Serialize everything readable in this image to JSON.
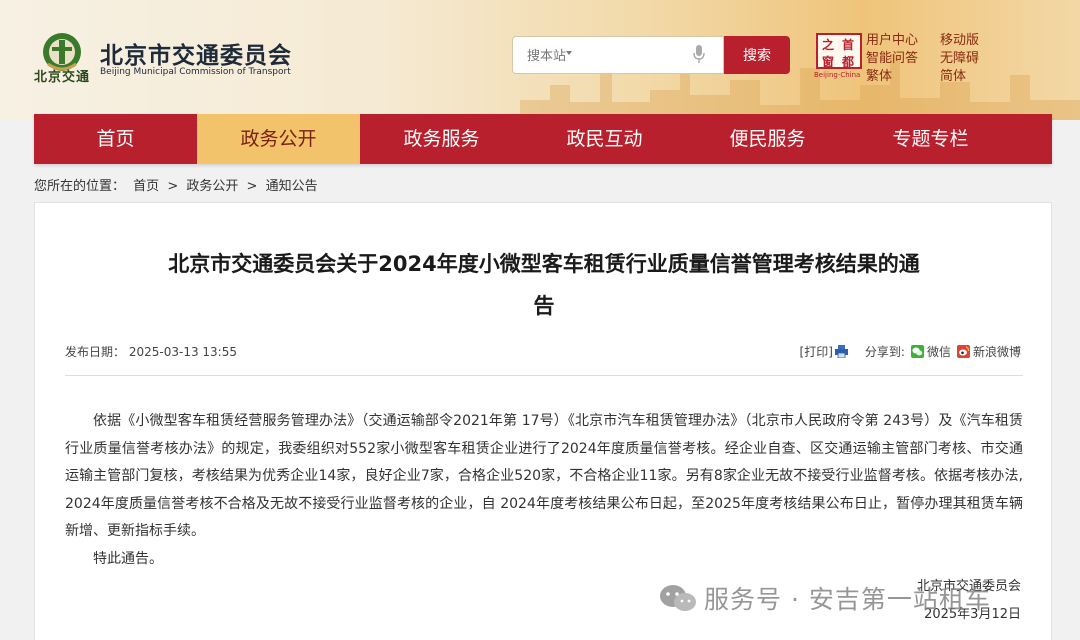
{
  "header": {
    "logo_sub": "北京交通",
    "title": "北京市交通委员会",
    "subtitle": "Beijing Municipal Commission of Transport",
    "search_placeholder": "搜本站",
    "search_button": "搜索",
    "capital_logo": [
      "之",
      "首",
      "都",
      "窗"
    ],
    "capital_tag": "Beijing-China",
    "links": [
      "用户中心",
      "移动版",
      "智能问答",
      "无障碍",
      "繁体",
      "简体"
    ]
  },
  "nav": {
    "items": [
      "首页",
      "政务公开",
      "政务服务",
      "政民互动",
      "便民服务",
      "专题专栏"
    ],
    "active": "政务公开"
  },
  "breadcrumb": {
    "prefix": "您所在的位置：",
    "items": [
      "首页",
      ">",
      "政务公开",
      ">",
      "通知公告"
    ]
  },
  "article": {
    "title_line1": "北京市交通委员会关于2024年度小微型客车租赁行业质量信誉管理考核结果的通",
    "title_line2": "告",
    "date_label": "发布日期：",
    "date_value": "2025-03-13 13:55",
    "print_label": "[打印]",
    "share_label": "分享到:",
    "wechat_label": "微信",
    "weibo_label": "新浪微博",
    "paragraph1": "依据《小微型客车租赁经营服务管理办法》（交通运输部令2021年第 17号）《北京市汽车租赁管理办法》（北京市人民政府令第 243号）及《汽车租赁行业质量信誉考核办法》的规定，我委组织对552家小微型客车租赁企业进行了2024年度质量信誉考核。经企业自查、区交通运输主管部门考核、市交通运输主管部门复核，考核结果为优秀企业14家，良好企业7家，合格企业520家，不合格企业11家。另有8家企业无故不接受行业监督考核。依据考核办法, 2024年度质量信誉考核不合格及无故不接受行业监督考核的企业，自 2024年度考核结果公布日起，至2025年度考核结果公布日止，暂停办理其租赁车辆新增、更新指标手续。",
    "paragraph2": "特此通告。",
    "sign_org": "北京市交通委员会",
    "sign_date": "2025年3月12日"
  },
  "watermark": "服务号 · 安吉第一站租车",
  "colors": {
    "brand_red": "#b8202d",
    "nav_active": "#f3c36c"
  }
}
